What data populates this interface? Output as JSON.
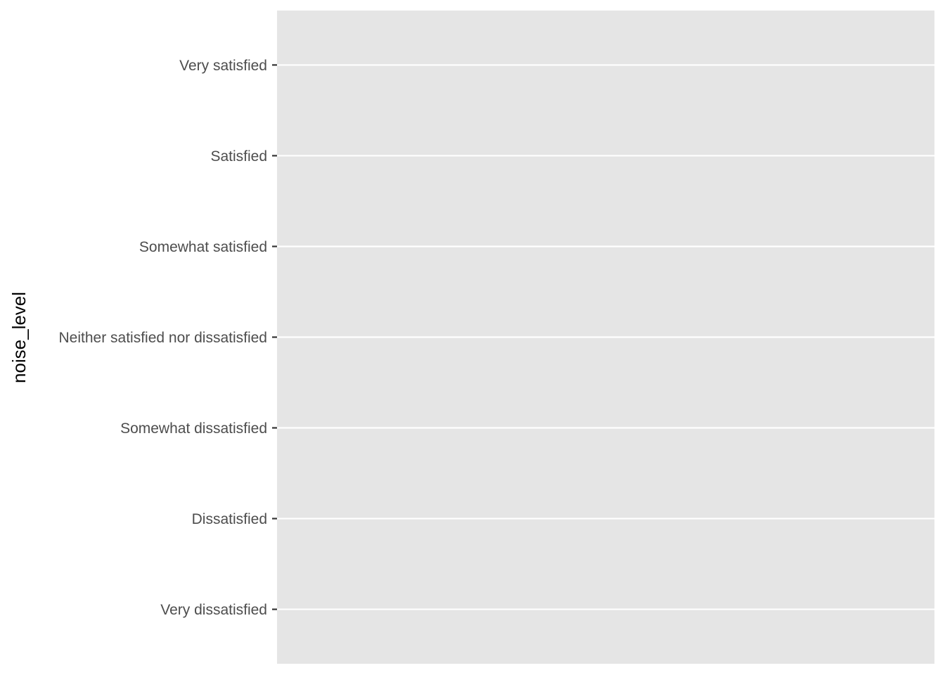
{
  "chart_data": {
    "type": "bar",
    "orientation": "horizontal",
    "ylabel": "noise_level",
    "xlabel": "",
    "categories": [
      "Very satisfied",
      "Satisfied",
      "Somewhat satisfied",
      "Neither satisfied nor dissatisfied",
      "Somewhat dissatisfied",
      "Dissatisfied",
      "Very dissatisfied"
    ],
    "series": [],
    "grid": true,
    "legend": "none",
    "colors": {
      "panel_background": "#e5e5e5",
      "grid_line": "#ffffff",
      "tick_label": "#4d4d4d",
      "tick_mark": "#333333",
      "axis_title": "#000000"
    }
  }
}
